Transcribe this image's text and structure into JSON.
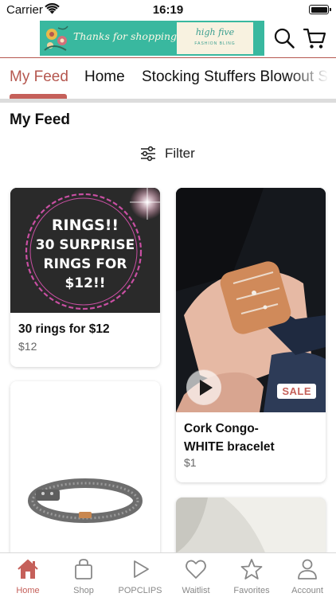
{
  "status_bar": {
    "carrier": "Carrier",
    "time": "16:19"
  },
  "banner": {
    "tagline": "Thanks for shopping!",
    "logo_text": "high five",
    "logo_sub": "FASHION BLING"
  },
  "header": {
    "search_icon": "search-icon",
    "cart_icon": "cart-icon"
  },
  "tabs": [
    {
      "label": "My Feed",
      "active": true
    },
    {
      "label": "Home",
      "active": false
    },
    {
      "label": "Stocking Stuffers Blowout Sale",
      "active": false
    }
  ],
  "page": {
    "title": "My Feed",
    "filter_label": "Filter"
  },
  "products": [
    {
      "title": "30 rings for $12",
      "price": "$12",
      "image_text": [
        "RINGS!!",
        "30 SURPRISE",
        "RINGS FOR",
        "$12!!"
      ]
    },
    {
      "title": "Cork Congo- WHITE bracelet",
      "title_lines": [
        "Cork Congo-",
        "WHITE bracelet"
      ],
      "price": "$1",
      "badge": "SALE",
      "has_video": true
    }
  ],
  "bottom_nav": [
    {
      "label": "Home",
      "icon": "home-icon",
      "active": true
    },
    {
      "label": "Shop",
      "icon": "shopping-bag-icon",
      "active": false
    },
    {
      "label": "POPCLIPS",
      "icon": "play-icon",
      "active": false
    },
    {
      "label": "Waitlist",
      "icon": "heart-icon",
      "active": false
    },
    {
      "label": "Favorites",
      "icon": "star-icon",
      "active": false
    },
    {
      "label": "Account",
      "icon": "person-icon",
      "active": false
    }
  ],
  "colors": {
    "accent": "#c5605a",
    "banner": "#39b89f",
    "inactive": "#888888"
  }
}
